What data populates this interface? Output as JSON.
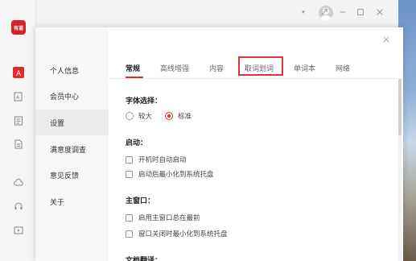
{
  "app": {
    "logo_text": "有道"
  },
  "rail": {
    "icons": [
      "translate-icon",
      "image-translate-icon",
      "document-icon",
      "file-icon",
      "cloud-icon",
      "headset-icon",
      "video-icon"
    ]
  },
  "dialog": {
    "nav": [
      {
        "label": "个人信息"
      },
      {
        "label": "会员中心"
      },
      {
        "label": "设置"
      },
      {
        "label": "满意度调查"
      },
      {
        "label": "意见反馈"
      },
      {
        "label": "关于"
      }
    ],
    "tabs": [
      {
        "label": "常规"
      },
      {
        "label": "高线增强"
      },
      {
        "label": "内容"
      },
      {
        "label": "取词划词"
      },
      {
        "label": "单词本"
      },
      {
        "label": "网络"
      }
    ],
    "font": {
      "title": "字体选择：",
      "option_large": "较大",
      "option_standard": "标准"
    },
    "startup": {
      "title": "启动：",
      "opt1": "开机时自动启动",
      "opt2": "启动后最小化到系统托盘"
    },
    "main_window": {
      "title": "主窗口：",
      "opt1": "启用主窗口总在最前",
      "opt2": "窗口关闭时最小化到系统托盘"
    },
    "doc_translate": {
      "title": "文档翻译："
    }
  },
  "colors": {
    "accent": "#e02b2b",
    "highlight_box": "#e0333a"
  }
}
